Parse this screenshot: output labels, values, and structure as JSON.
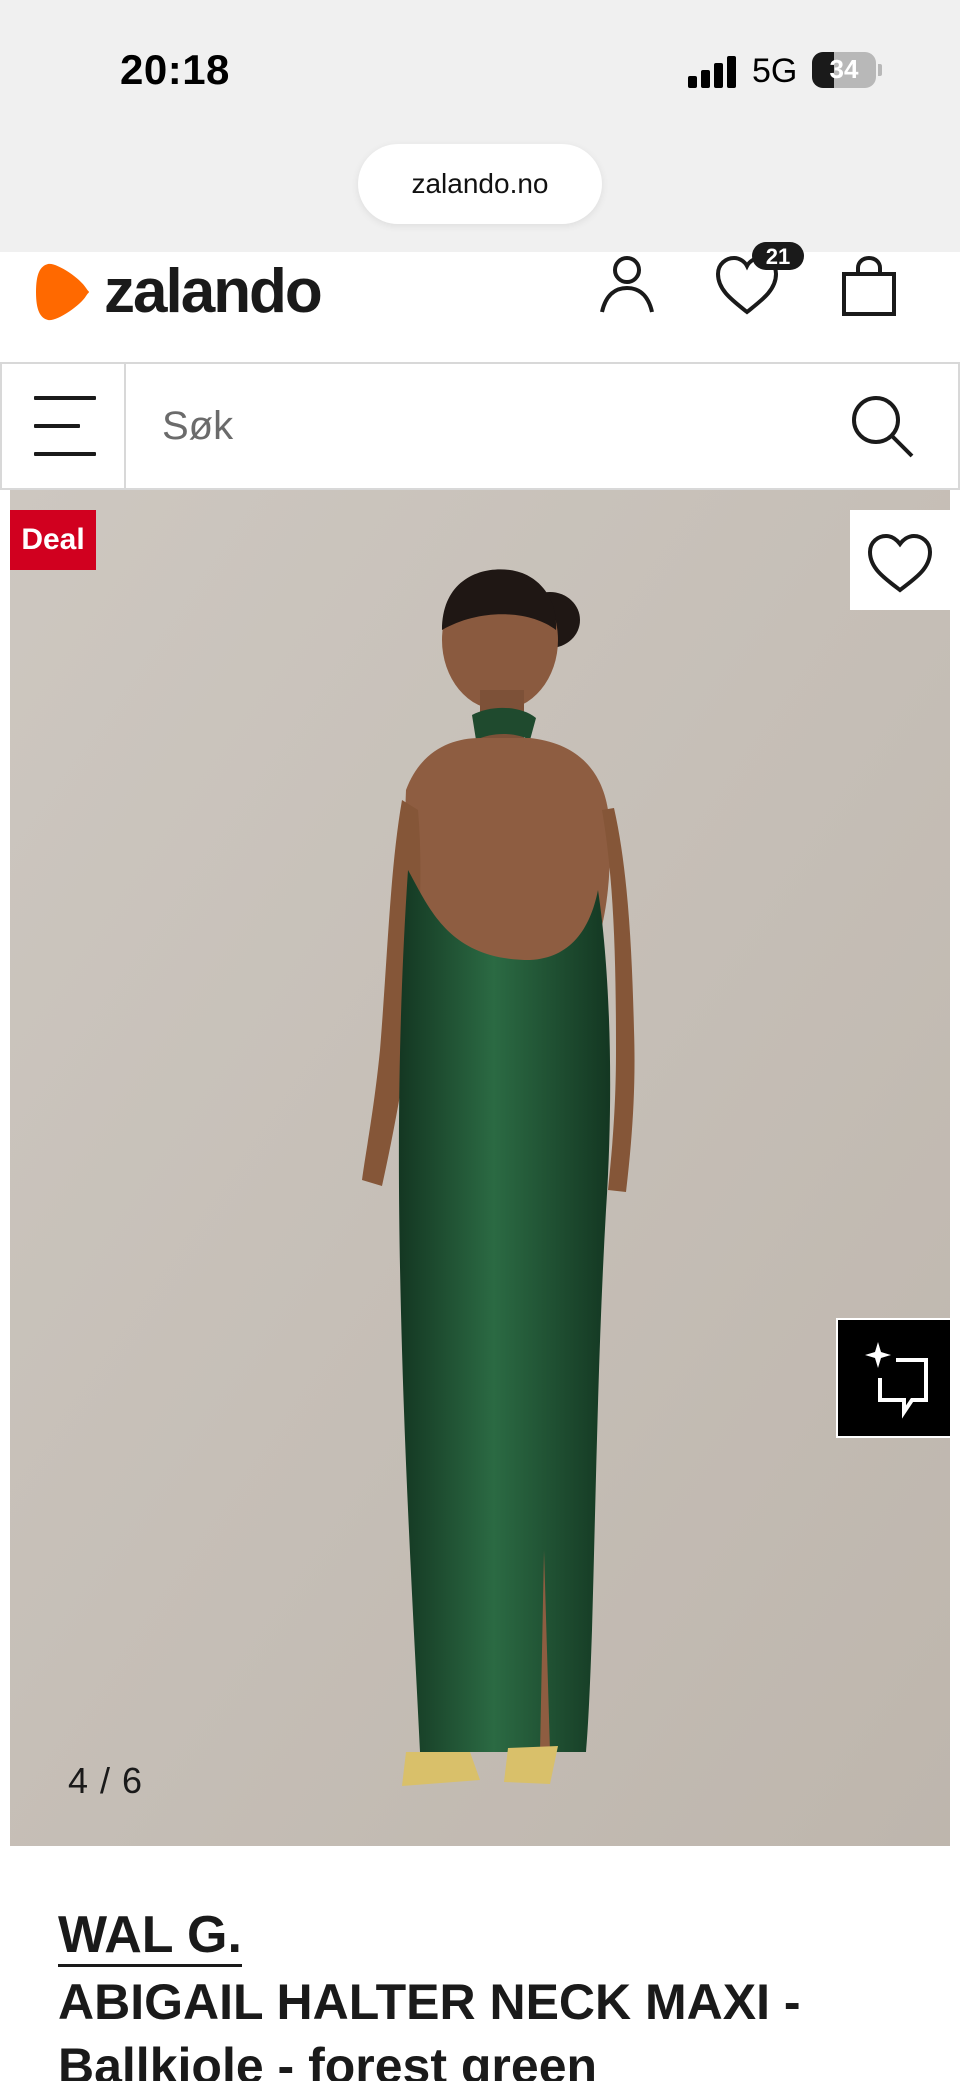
{
  "status_bar": {
    "time": "20:18",
    "network": "5G",
    "battery": "34",
    "battery_level_pct": 34
  },
  "browser": {
    "url": "zalando.no"
  },
  "header": {
    "logo_text": "zalando",
    "brand_color": "#ff6900",
    "wishlist_count": "21"
  },
  "search": {
    "placeholder": "Søk"
  },
  "product_image": {
    "badge": "Deal",
    "badge_color": "#d1001f",
    "counter": "4 / 6",
    "dress_color": "#1f4a2e",
    "backdrop_color": "#c9c2bb"
  },
  "product": {
    "brand": "WAL G.",
    "title": "ABIGAIL HALTER NECK MAXI - Ballkjole - forest green"
  },
  "icons": {
    "menu": "hamburger-icon",
    "search": "search-icon",
    "account": "user-icon",
    "wishlist": "heart-icon",
    "bag": "shopping-bag-icon",
    "ai": "sparkle-chat-icon"
  }
}
